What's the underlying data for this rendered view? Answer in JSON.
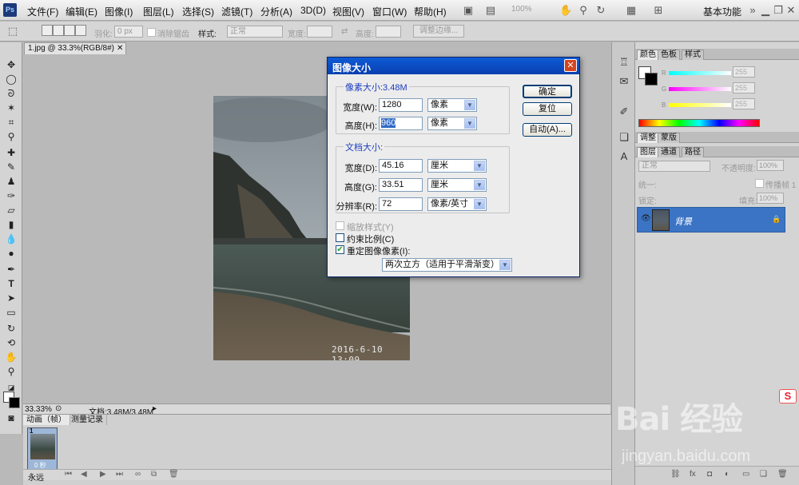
{
  "menubar": {
    "items": [
      "文件(F)",
      "编辑(E)",
      "图像(I)",
      "图层(L)",
      "选择(S)",
      "滤镜(T)",
      "分析(A)",
      "3D(D)",
      "视图(V)",
      "窗口(W)",
      "帮助(H)"
    ],
    "zoom": "100%",
    "workspace": "基本功能"
  },
  "options": {
    "feather_label": "羽化:",
    "feather_value": "0 px",
    "antialias_label": "消除锯齿",
    "style_label": "样式:",
    "style_value": "正常",
    "width_label": "宽度:",
    "height_label": "高度:",
    "refine_label": "调整边缘..."
  },
  "document": {
    "tab_label": "1.jpg @ 33.3%(RGB/8#)",
    "photo_timestamp": "2016-6-10 13:09",
    "status_zoom": "33.33%",
    "status_doc": "文档:3.48M/3.48M"
  },
  "animation": {
    "tabs": [
      "动画（帧）",
      "测量记录"
    ],
    "frame_number": "1",
    "frame_delay": "0 秒",
    "loop": "永远"
  },
  "color_panel": {
    "tabs": [
      "颜色",
      "色板",
      "样式"
    ],
    "r_label": "R",
    "r_value": "255",
    "g_label": "G",
    "g_value": "255",
    "b_label": "B",
    "b_value": "255"
  },
  "adjust_panel": {
    "tabs": [
      "调整",
      "蒙版"
    ]
  },
  "layers_panel": {
    "tabs": [
      "图层",
      "通道",
      "路径"
    ],
    "blend_mode": "正常",
    "opacity_label": "不透明度:",
    "opacity_value": "100%",
    "unify_label": "统一:",
    "propagate_label": "传播帧 1",
    "lock_label": "锁定:",
    "fill_label": "填充:",
    "fill_value": "100%",
    "layer_name": "背景"
  },
  "dialog": {
    "title": "图像大小",
    "pixel_group_title": "像素大小:3.48M",
    "pixel_width_label": "宽度(W):",
    "pixel_width_value": "1280",
    "pixel_width_unit": "像素",
    "pixel_height_label": "高度(H):",
    "pixel_height_value": "960",
    "pixel_height_unit": "像素",
    "doc_group_title": "文档大小:",
    "doc_width_label": "宽度(D):",
    "doc_width_value": "45.16",
    "doc_width_unit": "厘米",
    "doc_height_label": "高度(G):",
    "doc_height_value": "33.51",
    "doc_height_unit": "厘米",
    "resolution_label": "分辨率(R):",
    "resolution_value": "72",
    "resolution_unit": "像素/英寸",
    "scale_styles_label": "缩放样式(Y)",
    "constrain_label": "约束比例(C)",
    "resample_label": "重定图像像素(I):",
    "resample_method": "两次立方（适用于平滑渐变）",
    "ok_label": "确定",
    "reset_label": "复位",
    "auto_label": "自动(A)..."
  },
  "watermark": {
    "text": "Bai 经验",
    "sub": "jingyan.baidu.com",
    "icon": "S"
  }
}
